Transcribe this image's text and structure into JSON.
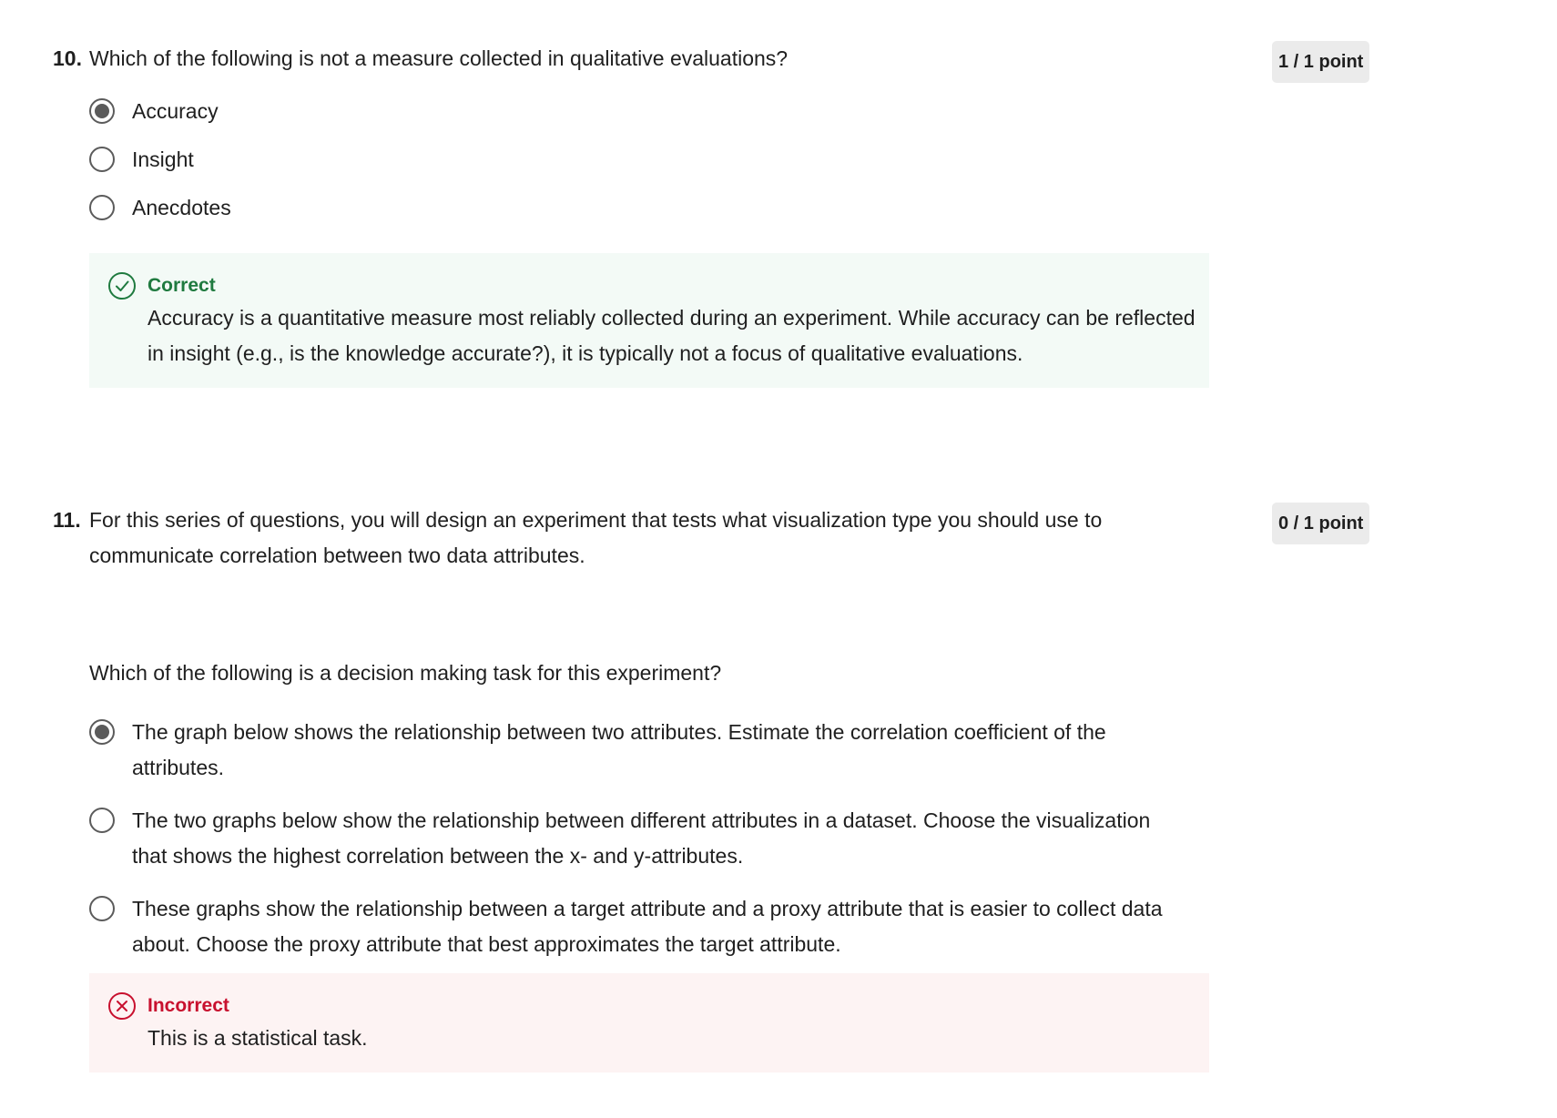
{
  "q10": {
    "number": "10.",
    "text": "Which of the following is not a measure collected in qualitative evaluations?",
    "points": "1 / 1 point",
    "options": [
      {
        "label": "Accuracy",
        "selected": true
      },
      {
        "label": "Insight",
        "selected": false
      },
      {
        "label": "Anecdotes",
        "selected": false
      }
    ],
    "feedback": {
      "status": "Correct",
      "text": "Accuracy is a quantitative measure most reliably collected during an experiment. While accuracy can be reflected in insight (e.g., is the knowledge accurate?), it is typically not a focus of qualitative evaluations.",
      "icon": "check-circle-icon",
      "color": "#1f7a3f"
    }
  },
  "q11": {
    "number": "11.",
    "text": "For this series of questions, you will design an experiment that tests what visualization type you should use to communicate correlation between two data attributes.",
    "points": "0 / 1 point",
    "prompt": "Which of the following is a decision making task for this experiment?",
    "options": [
      {
        "label": "The graph below shows the relationship between two attributes. Estimate the correlation coefficient of the attributes.",
        "selected": true
      },
      {
        "label": "The two graphs below show the relationship between different attributes in a dataset. Choose the visualization that shows the highest correlation between the x- and y-attributes.",
        "selected": false
      },
      {
        "label": "These graphs show the relationship between a target attribute and a proxy attribute that is easier to collect data about. Choose the proxy attribute that best approximates the target attribute.",
        "selected": false
      }
    ],
    "feedback": {
      "status": "Incorrect",
      "text": "This is a statistical task.",
      "icon": "x-circle-icon",
      "color": "#c8102e"
    }
  }
}
